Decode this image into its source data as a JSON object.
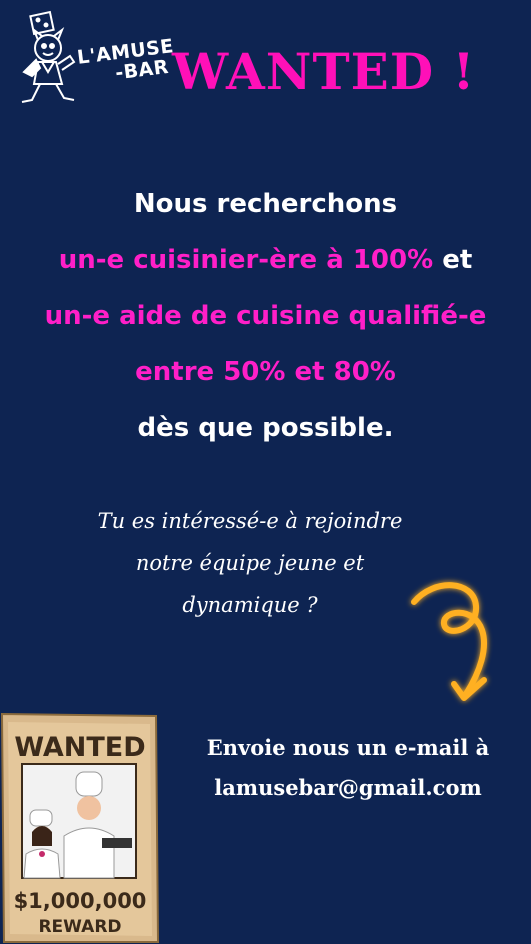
{
  "header": {
    "logo_line1": "L'AMUSE",
    "logo_line2": "-BAR",
    "title": "WANTED !"
  },
  "announcement": {
    "line1": "Nous recherchons",
    "line2_pink": "un-e cuisinier-ère à 100%",
    "line2_white": " et",
    "line3": "un-e aide de cuisine qualifié-e",
    "line4": "entre 50% et 80%",
    "line5": "dès que possible."
  },
  "invitation": {
    "line1": "Tu es intéressé-e à rejoindre",
    "line2": "notre équipe jeune et",
    "line3": "dynamique ?"
  },
  "poster": {
    "top": "WANTED",
    "amount": "$1,000,000",
    "bottom": "REWARD"
  },
  "contact": {
    "line1": "Envoie nous  un e-mail à",
    "line2": "lamusebar@gmail.com"
  },
  "colors": {
    "background": "#0e2452",
    "accent_pink": "#ff10b8",
    "arrow_orange": "#ffb020"
  }
}
